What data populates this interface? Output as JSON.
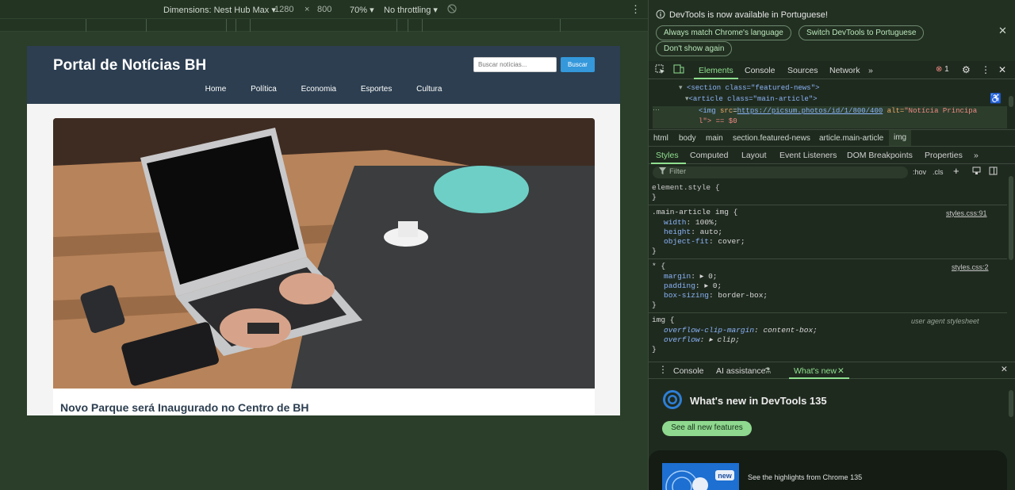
{
  "emulation": {
    "dimensions_label": "Dimensions: Nest Hub Max",
    "width": "1280",
    "times": "×",
    "height": "800",
    "zoom": "70%",
    "throttling": "No throttling"
  },
  "site": {
    "title": "Portal de Notícias BH",
    "search_placeholder": "Buscar notícias...",
    "search_button": "Buscar",
    "nav": [
      "Home",
      "Política",
      "Economia",
      "Esportes",
      "Cultura"
    ],
    "article_title": "Novo Parque será Inaugurado no Centro de BH"
  },
  "devtools": {
    "infobar": {
      "text": "DevTools is now available in Portuguese!",
      "btn_match": "Always match Chrome's language",
      "btn_switch": "Switch DevTools to Portuguese",
      "btn_dont_show": "Don't show again"
    },
    "tabs": [
      "Elements",
      "Console",
      "Sources",
      "Network"
    ],
    "error_count": "1",
    "dom": {
      "line1_tag": "<section class=\"featured-news\">",
      "line2_tag": "<article class=\"main-article\">",
      "img_src": "https://picsum.photos/id/1/800/400",
      "img_alt_name": "alt=",
      "img_alt_value": "\"Notícia Principa",
      "img_alt_cont": "l\"> == $0"
    },
    "breadcrumbs": [
      "html",
      "body",
      "main",
      "section.featured-news",
      "article.main-article",
      "img"
    ],
    "subtabs": [
      "Styles",
      "Computed",
      "Layout",
      "Event Listeners",
      "DOM Breakpoints",
      "Properties"
    ],
    "filter_placeholder": "Filter",
    "hov": ":hov",
    "cls": ".cls",
    "styles": {
      "element_style": "element.style {",
      "close": "}",
      "rule1_selector": ".main-article img {",
      "rule1_src": "styles.css:91",
      "rule1_props": [
        [
          "width",
          "100%;"
        ],
        [
          "height",
          "auto;"
        ],
        [
          "object-fit",
          "cover;"
        ]
      ],
      "rule2_selector": "* {",
      "rule2_src": "styles.css:2",
      "rule2_props": [
        [
          "margin",
          "▸ 0;"
        ],
        [
          "padding",
          "▸ 0;"
        ],
        [
          "box-sizing",
          "border-box;"
        ]
      ],
      "rule3_selector": "img {",
      "rule3_src": "user agent stylesheet",
      "rule3_props": [
        [
          "overflow-clip-margin",
          "content-box;"
        ],
        [
          "overflow",
          "▸ clip;"
        ]
      ]
    },
    "drawer": {
      "tabs": [
        "Console",
        "AI assistance",
        "What's new"
      ],
      "title": "What's new in DevTools 135",
      "button": "See all new features",
      "badge": "new",
      "card_text": "See the highlights from Chrome 135"
    }
  }
}
